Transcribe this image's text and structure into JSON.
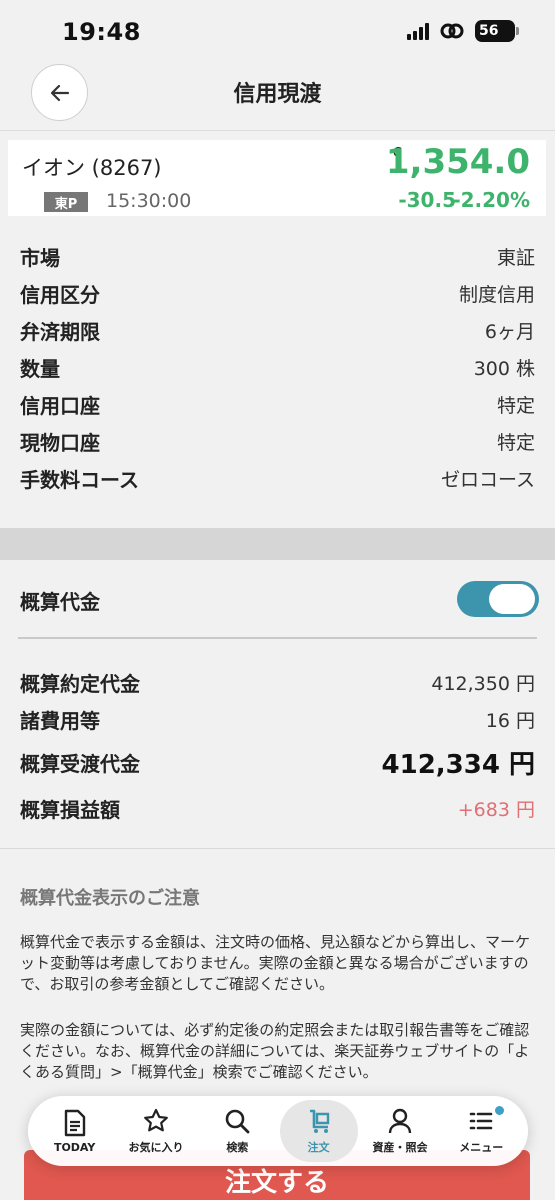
{
  "status_bar": {
    "time": "19:48",
    "battery": "56"
  },
  "header": {
    "title": "信用現渡"
  },
  "stock": {
    "name": "イオン (8267)",
    "market_badge": "東P",
    "time": "15:30:00",
    "price_flag": "C",
    "price": "1,354.0",
    "change": "-30.5",
    "change_pct": "-2.20%",
    "price_color": "#3db36b"
  },
  "info": [
    {
      "label": "市場",
      "value": "東証"
    },
    {
      "label": "信用区分",
      "value": "制度信用"
    },
    {
      "label": "弁済期限",
      "value": "6ヶ月"
    },
    {
      "label": "数量",
      "value": "300 株"
    },
    {
      "label": "信用口座",
      "value": "特定"
    },
    {
      "label": "現物口座",
      "value": "特定"
    },
    {
      "label": "手数料コース",
      "value": "ゼロコース"
    }
  ],
  "estimate": {
    "toggle_label": "概算代金",
    "toggle_on": true,
    "toggle_color": "#3d95ad",
    "rows": [
      {
        "label": "概算約定代金",
        "value": "412,350 円"
      },
      {
        "label": "諸費用等",
        "value": "16 円"
      },
      {
        "label": "概算受渡代金",
        "value": "412,334 円"
      },
      {
        "label": "概算損益額",
        "value": "+683 円"
      }
    ],
    "profit_color": "#e07074"
  },
  "notice": {
    "title": "概算代金表示のご注意",
    "paragraph1": "概算代金で表示する金額は、注文時の価格、見込額などから算出し、マーケット変動等は考慮しておりません。実際の金額と異なる場合がございますので、お取引の参考金額としてご確認ください。",
    "paragraph2": "実際の金額については、必ず約定後の約定照会または取引報告書等をご確認ください。なお、概算代金の詳細については、楽天証券ウェブサイトの「よくある質問」>「概算代金」検索でご確認ください。"
  },
  "order_button": {
    "label": "注文する",
    "color": "#e0584f"
  },
  "nav": [
    {
      "label": "TODAY",
      "icon": "document-icon"
    },
    {
      "label": "お気に入り",
      "icon": "star-icon"
    },
    {
      "label": "検索",
      "icon": "search-icon"
    },
    {
      "label": "注文",
      "icon": "cart-icon",
      "active": true
    },
    {
      "label": "資産・照会",
      "icon": "person-icon"
    },
    {
      "label": "メニュー",
      "icon": "menu-icon"
    }
  ]
}
